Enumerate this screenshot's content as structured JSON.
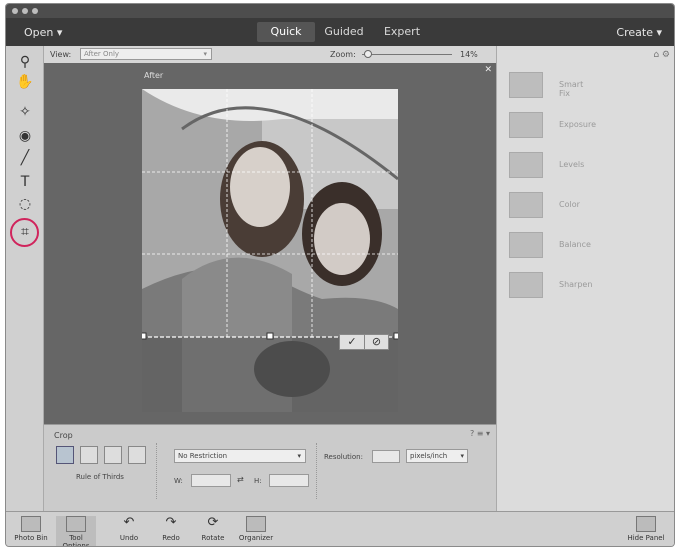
{
  "menu": {
    "open_label": "Open",
    "tabs": [
      "Quick",
      "Guided",
      "Expert"
    ],
    "create_label": "Create"
  },
  "options": {
    "view_label": "View:",
    "view_value": "After Only",
    "zoom_label": "Zoom:",
    "zoom_value": "14%"
  },
  "canvas": {
    "after_label": "After"
  },
  "right_panel": {
    "items": [
      "Smart Fix",
      "Exposure",
      "Levels",
      "Color",
      "Balance",
      "Sharpen"
    ]
  },
  "crop": {
    "title": "Crop",
    "grid_label": "Rule of Thirds",
    "restriction": "No Restriction",
    "w_label": "W:",
    "h_label": "H:",
    "resolution_label": "Resolution:",
    "unit": "pixels/inch"
  },
  "bottom": {
    "items": [
      "Photo Bin",
      "Tool Options",
      "Undo",
      "Redo",
      "Rotate",
      "Organizer"
    ],
    "hide_panel": "Hide Panel"
  },
  "colors": {
    "accent_ring": "#d0245c",
    "menubar": "#3a3a3a"
  }
}
